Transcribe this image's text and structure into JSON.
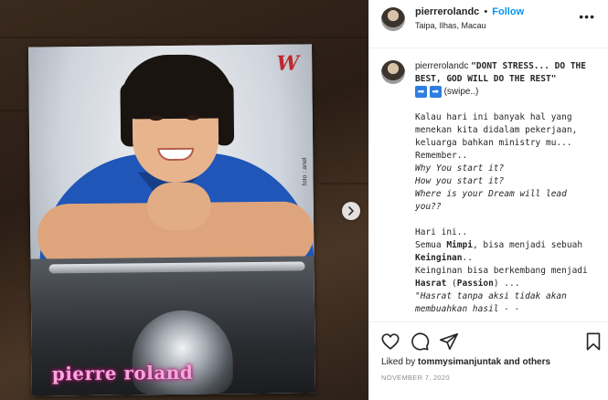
{
  "post": {
    "image": {
      "poster_title": "pierre roland",
      "poster_logo": "W",
      "photo_credit": "foto : ariel"
    },
    "header": {
      "username": "pierrerolandc",
      "separator": "•",
      "follow_label": "Follow",
      "location": "Taipa, Ilhas, Macau",
      "more_icon": "more-icon"
    },
    "caption": {
      "username": "pierrerolandc",
      "quote": "\"DONT STRESS... DO THE BEST, GOD WILL DO THE REST\"",
      "swipe_text": "(swipe..)",
      "paragraph1": "Kalau hari ini banyak hal yang menekan kita didalam pekerjaan, keluarga bahkan ministry mu... Remember..",
      "q1": "Why You start it?",
      "q2": "How you start it?",
      "q3": "Where is your Dream will lead you??",
      "hari_ini": "Hari ini..",
      "semua_pre": "Semua ",
      "mimpi": "Mimpi",
      "semua_post": ", bisa menjadi sebuah",
      "keinginan": "Keinginan",
      "keinginan_post": "..",
      "line_bisa": "Keinginan bisa berkembang menjadi",
      "hasrat": "Hasrat",
      "passion_open": " (",
      "passion": "Passion",
      "passion_close": ") ...",
      "quote2": "\"Hasrat tanpa aksi tidak akan membuahkan hasil - -"
    },
    "actions": {
      "liked_by_prefix": "Liked by ",
      "liked_by_user": "tommysimanjuntak",
      "liked_by_suffix": " and others",
      "date": "NOVEMBER 7, 2020"
    }
  }
}
